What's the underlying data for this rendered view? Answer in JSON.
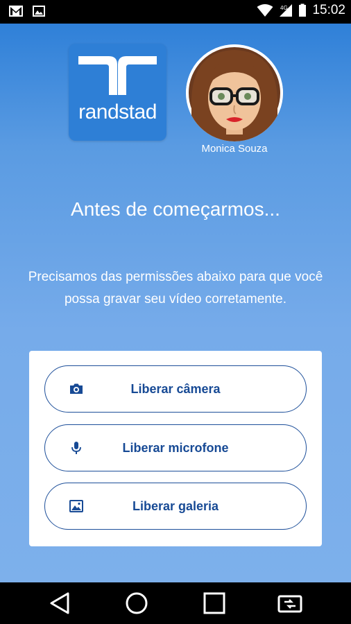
{
  "status_bar": {
    "time": "15:02",
    "left_icons": [
      "gmail-icon",
      "gallery-icon"
    ],
    "right_icons": [
      "wifi-icon",
      "signal-icon",
      "battery-icon"
    ]
  },
  "brand": {
    "logo_text": "randstad",
    "logo_color": "#2e7fd6"
  },
  "recruiter": {
    "name": "Monica Souza"
  },
  "headline": "Antes de começarmos...",
  "description": "Precisamos das permissões abaixo para que você possa gravar seu vídeo corretamente.",
  "permissions": [
    {
      "icon": "camera-icon",
      "label": "Liberar câmera"
    },
    {
      "icon": "microphone-icon",
      "label": "Liberar microfone"
    },
    {
      "icon": "gallery-icon",
      "label": "Liberar galeria"
    }
  ],
  "nav_bar": {
    "items": [
      "back-icon",
      "home-icon",
      "recents-icon",
      "screen-rotate-icon"
    ]
  },
  "colors": {
    "accent": "#174a95",
    "background_top": "#2f80d8",
    "background_bottom": "#7db0eb"
  }
}
